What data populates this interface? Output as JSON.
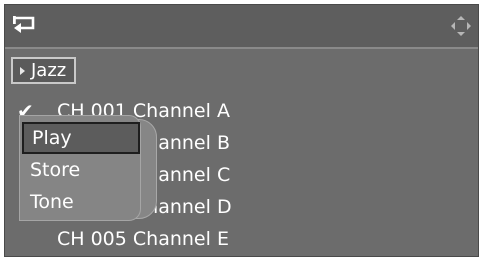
{
  "category": {
    "label": "Jazz"
  },
  "channels": [
    {
      "label": "CH 001 Channel A",
      "checked": true
    },
    {
      "label": "CH 002 Channel B",
      "checked": false
    },
    {
      "label": "CH 003 Channel C",
      "checked": false
    },
    {
      "label": "CH 004 Channel D",
      "checked": false
    },
    {
      "label": "CH 005 Channel E",
      "checked": false
    }
  ],
  "context_menu": {
    "items": [
      {
        "label": "Play",
        "selected": true
      },
      {
        "label": "Store",
        "selected": false
      },
      {
        "label": "Tone",
        "selected": false
      }
    ]
  },
  "icons": {
    "back": "back-arrow-icon",
    "nav": "directional-pad-icon",
    "check": "check-icon",
    "category_marker": "triangle-right-icon"
  },
  "colors": {
    "panel": "#6c6c6c",
    "text": "#ffffff",
    "selection_border": "#1e1e1e"
  }
}
